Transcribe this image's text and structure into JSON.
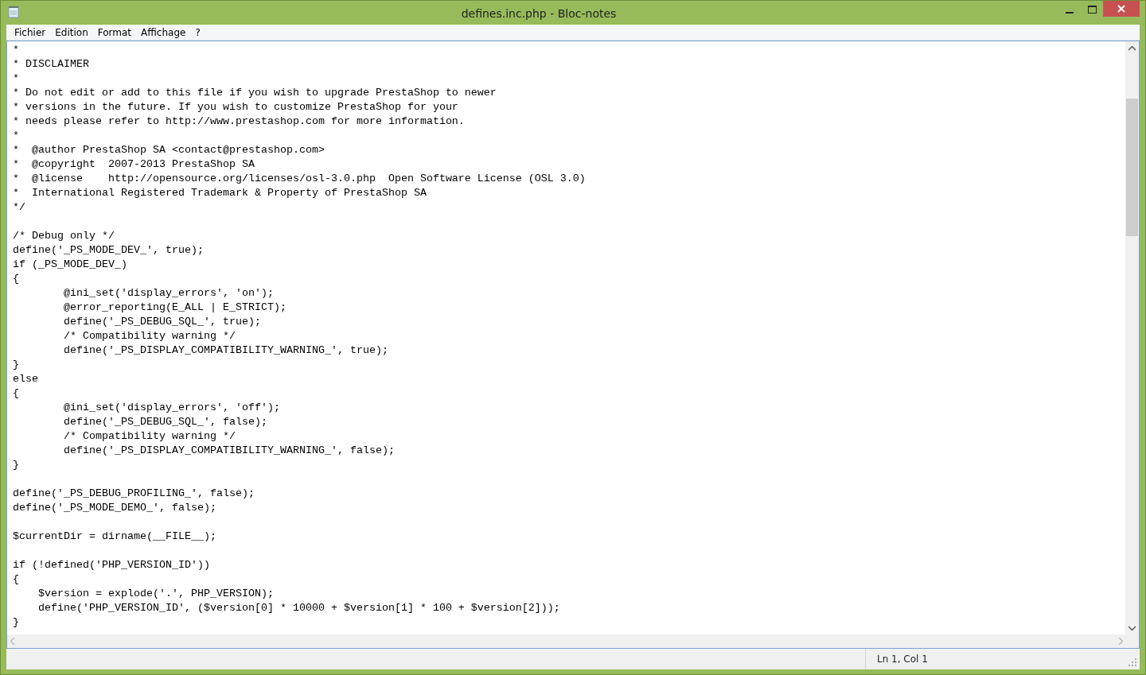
{
  "window": {
    "title": "defines.inc.php - Bloc-notes"
  },
  "menu": [
    "Fichier",
    "Edition",
    "Format",
    "Affichage",
    "?"
  ],
  "editor": {
    "blocks": [
      [
        "*",
        "* DISCLAIMER",
        "*",
        "* Do not edit or add to this file if you wish to upgrade PrestaShop to newer",
        "* versions in the future. If you wish to customize PrestaShop for your",
        "* needs please refer to http://www.prestashop.com for more information.",
        "*",
        "*  @author PrestaShop SA <contact@prestashop.com>",
        "*  @copyright  2007-2013 PrestaShop SA",
        "*  @license    http://opensource.org/licenses/osl-3.0.php  Open Software License (OSL 3.0)",
        "*  International Registered Trademark & Property of PrestaShop SA",
        "*/"
      ],
      [
        "/* Debug only */",
        "define('_PS_MODE_DEV_', true);",
        "if (_PS_MODE_DEV_)",
        "{",
        "\t@ini_set('display_errors', 'on');",
        "\t@error_reporting(E_ALL | E_STRICT);",
        "\tdefine('_PS_DEBUG_SQL_', true);",
        "\t/* Compatibility warning */",
        "\tdefine('_PS_DISPLAY_COMPATIBILITY_WARNING_', true);",
        "}",
        "else",
        "{",
        "\t@ini_set('display_errors', 'off');",
        "\tdefine('_PS_DEBUG_SQL_', false);",
        "\t/* Compatibility warning */",
        "\tdefine('_PS_DISPLAY_COMPATIBILITY_WARNING_', false);",
        "}"
      ],
      [
        "define('_PS_DEBUG_PROFILING_', false);",
        "define('_PS_MODE_DEMO_', false);"
      ],
      [
        "$currentDir = dirname(__FILE__);"
      ],
      [
        "if (!defined('PHP_VERSION_ID'))",
        "{",
        "    $version = explode('.', PHP_VERSION);",
        "    define('PHP_VERSION_ID', ($version[0] * 10000 + $version[1] * 100 + $version[2]));",
        "}"
      ]
    ]
  },
  "status_bar": {
    "position": "Ln 1, Col 1"
  }
}
